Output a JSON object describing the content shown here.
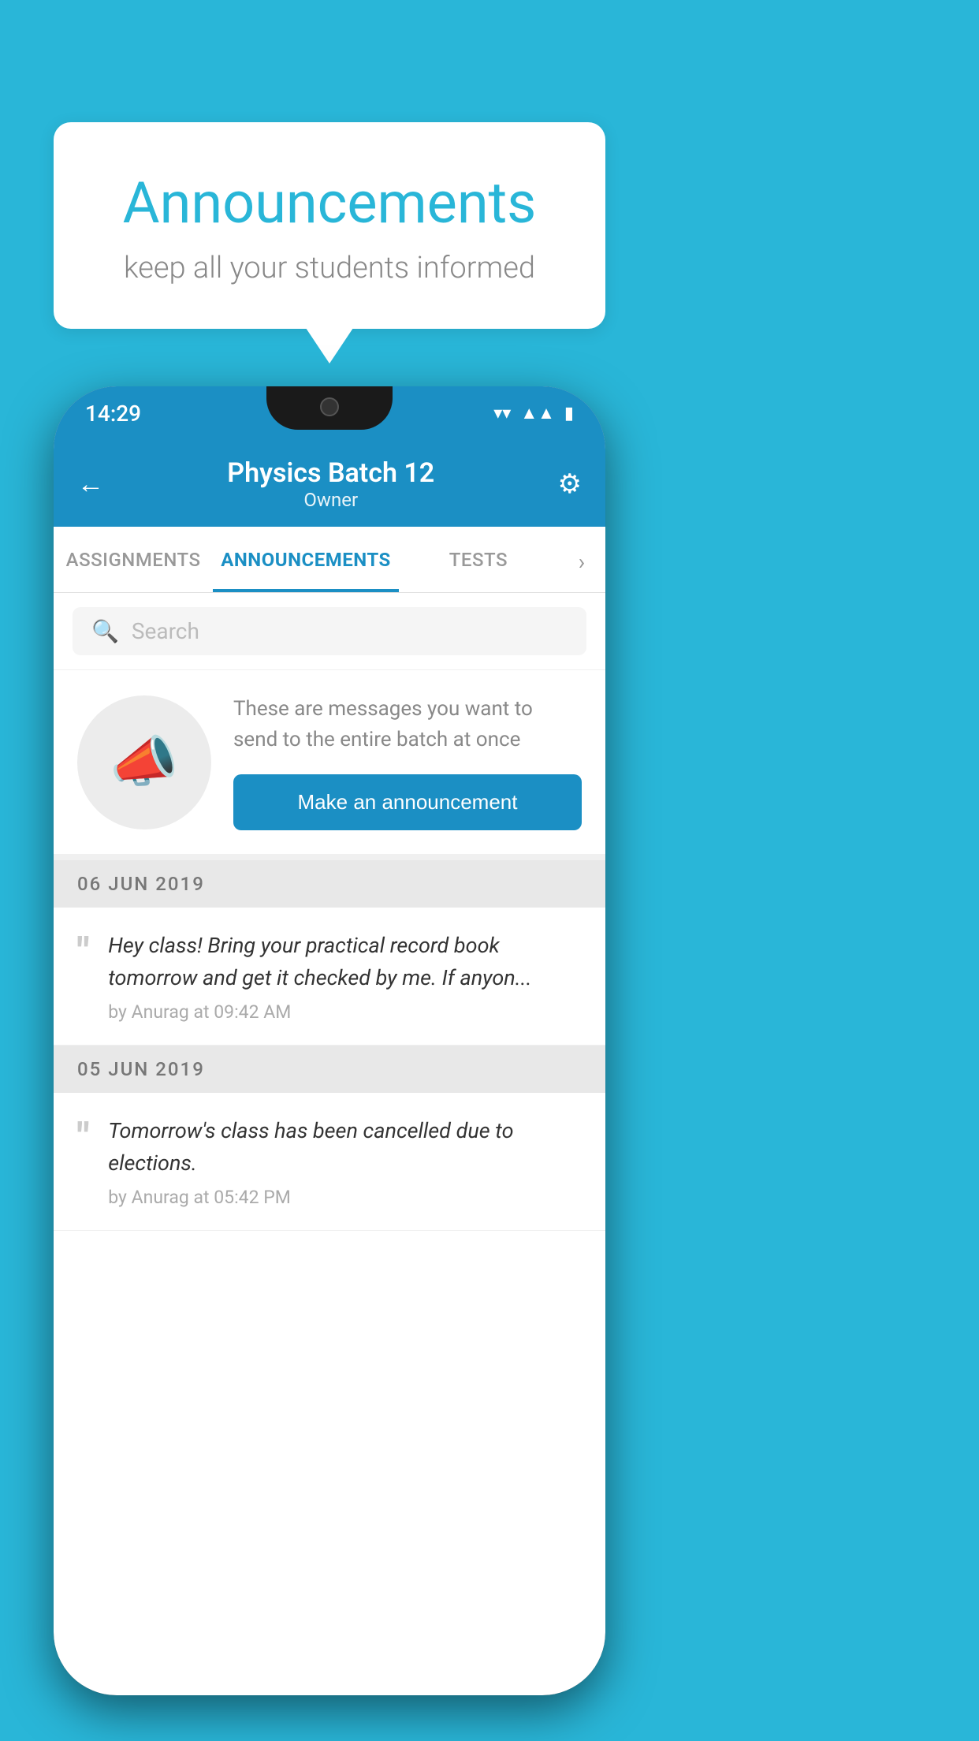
{
  "background_color": "#29b6d8",
  "speech_bubble": {
    "title": "Announcements",
    "subtitle": "keep all your students informed"
  },
  "phone": {
    "status_bar": {
      "time": "14:29",
      "wifi_icon": "▲",
      "signal_icon": "▲",
      "battery_icon": "▮"
    },
    "header": {
      "back_label": "←",
      "batch_name": "Physics Batch 12",
      "owner_label": "Owner",
      "gear_label": "⚙"
    },
    "tabs": [
      {
        "label": "ASSIGNMENTS",
        "active": false
      },
      {
        "label": "ANNOUNCEMENTS",
        "active": true
      },
      {
        "label": "TESTS",
        "active": false
      }
    ],
    "search": {
      "placeholder": "Search"
    },
    "cta_section": {
      "description": "These are messages you want to send to the entire batch at once",
      "button_label": "Make an announcement"
    },
    "announcements": [
      {
        "date": "06  JUN  2019",
        "text": "Hey class! Bring your practical record book tomorrow and get it checked by me. If anyon...",
        "meta": "by Anurag at 09:42 AM"
      },
      {
        "date": "05  JUN  2019",
        "text": "Tomorrow's class has been cancelled due to elections.",
        "meta": "by Anurag at 05:42 PM"
      }
    ]
  }
}
